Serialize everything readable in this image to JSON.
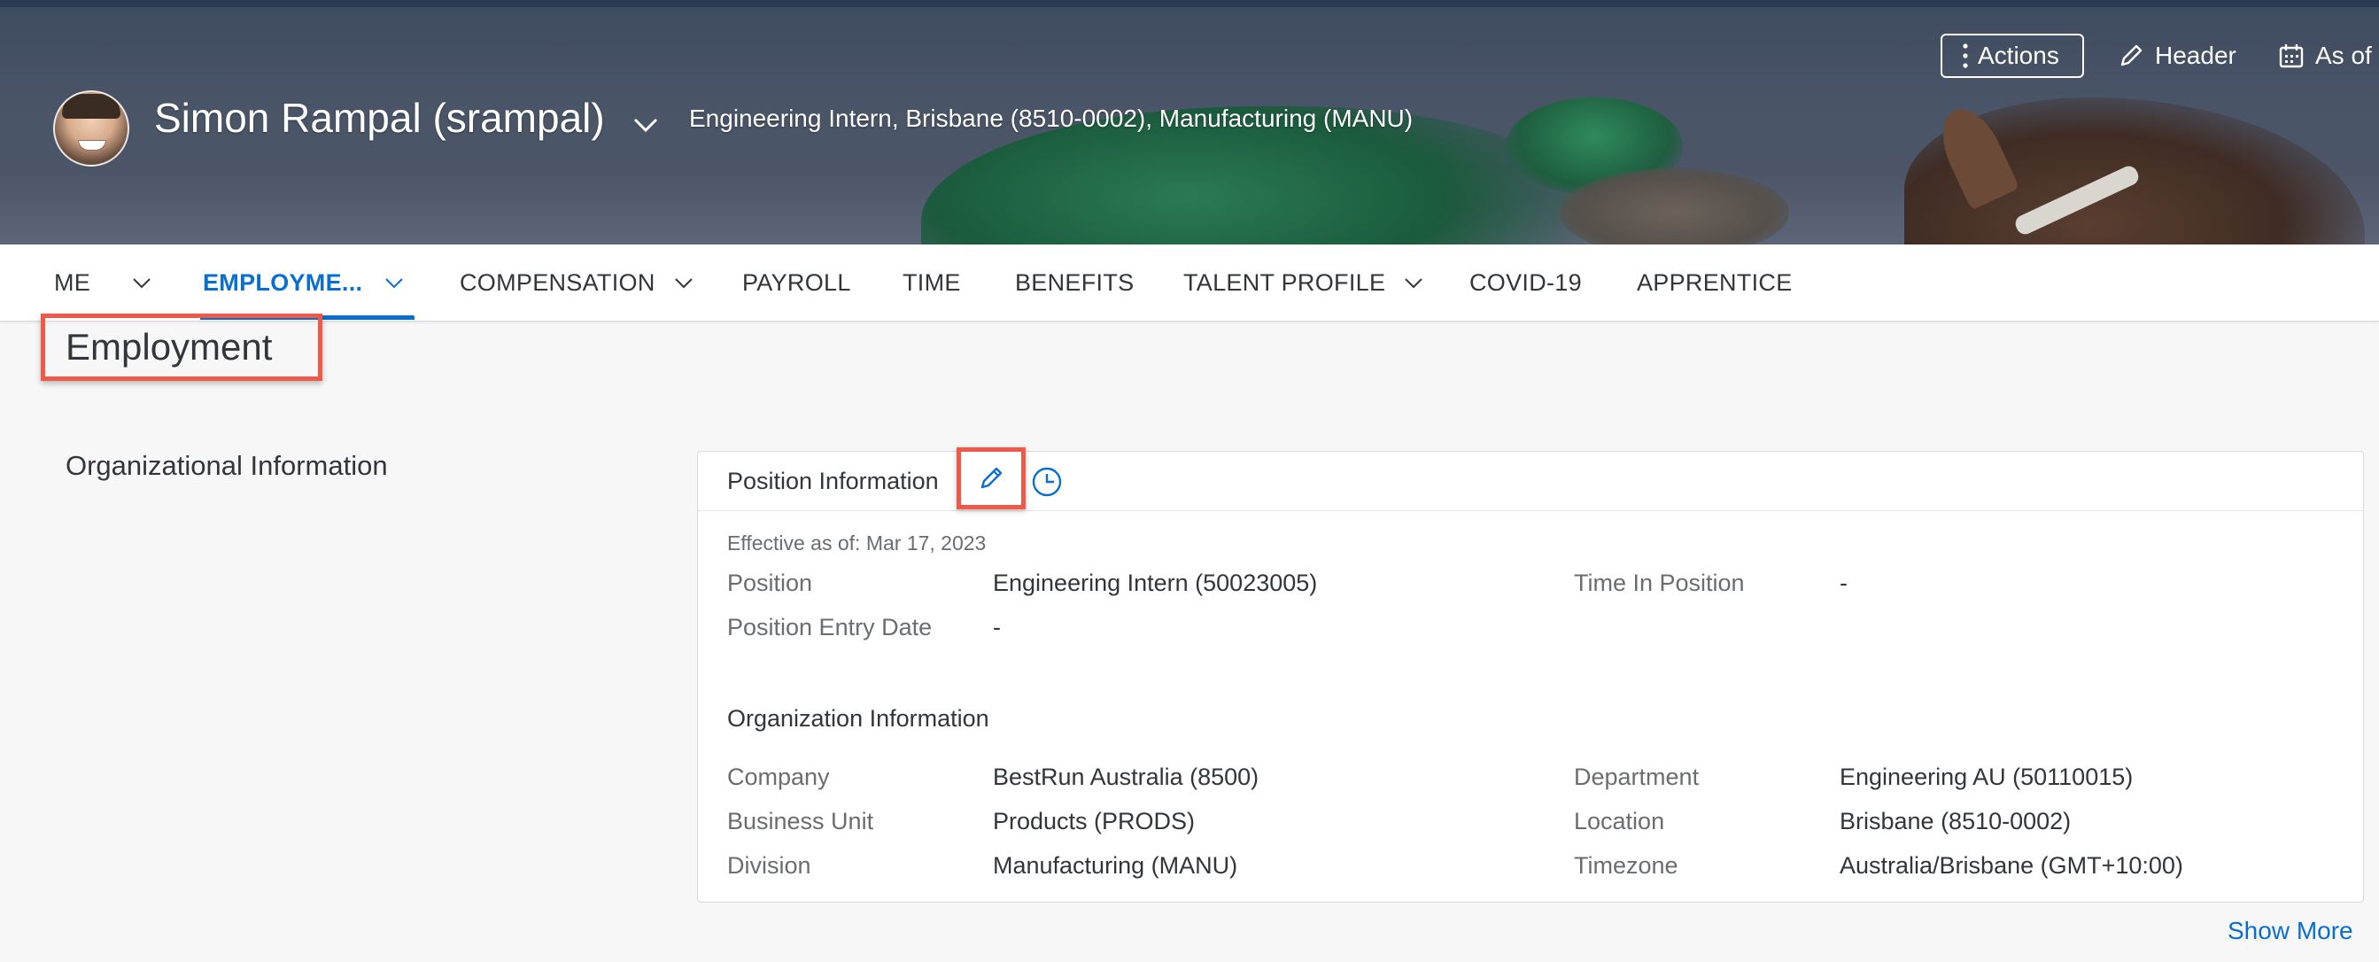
{
  "header": {
    "user_name": "Simon Rampal (srampal)",
    "subtitle": "Engineering Intern, Brisbane (8510-0002), Manufacturing (MANU)",
    "actions_label": "Actions",
    "header_label": "Header",
    "as_of_label": "As of"
  },
  "tabs": [
    {
      "label": "ME",
      "has_menu": true
    },
    {
      "label": "EMPLOYME...",
      "has_menu": true,
      "active": true
    },
    {
      "label": "COMPENSATION",
      "has_menu": true
    },
    {
      "label": "PAYROLL"
    },
    {
      "label": "TIME"
    },
    {
      "label": "BENEFITS"
    },
    {
      "label": "TALENT PROFILE",
      "has_menu": true
    },
    {
      "label": "COVID-19"
    },
    {
      "label": "APPRENTICE"
    }
  ],
  "page": {
    "title": "Employment",
    "section_title": "Organizational Information"
  },
  "card": {
    "title": "Position Information",
    "effective": "Effective as of: Mar 17, 2023",
    "position_fields": [
      {
        "label": "Position",
        "value": "Engineering Intern (50023005)"
      },
      {
        "label": "Time In Position",
        "value": "-"
      },
      {
        "label": "Position Entry Date",
        "value": "-"
      }
    ],
    "org_title": "Organization Information",
    "org_fields": [
      {
        "label": "Company",
        "value": "BestRun Australia (8500)"
      },
      {
        "label": "Department",
        "value": "Engineering AU (50110015)"
      },
      {
        "label": "Business Unit",
        "value": "Products (PRODS)"
      },
      {
        "label": "Location",
        "value": "Brisbane (8510-0002)"
      },
      {
        "label": "Division",
        "value": "Manufacturing (MANU)"
      },
      {
        "label": "Timezone",
        "value": "Australia/Brisbane (GMT+10:00)"
      }
    ],
    "show_more": "Show More"
  },
  "colors": {
    "accent": "#0a6ed1",
    "highlight": "#ef5a48"
  }
}
